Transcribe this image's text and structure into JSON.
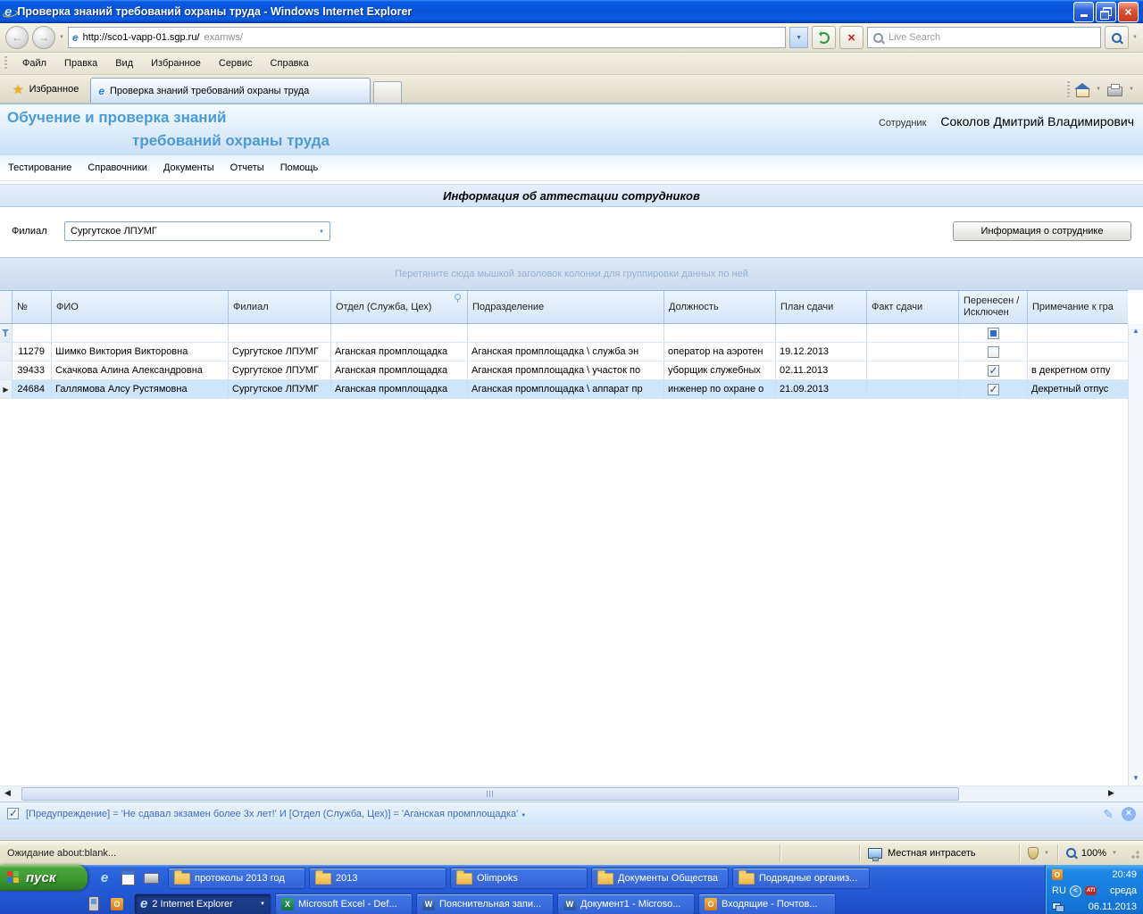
{
  "window": {
    "title": "Проверка знаний требований охраны труда - Windows Internet Explorer"
  },
  "browser": {
    "url_host": "http://sco1-vapp-01.sgp.ru/",
    "url_path": "examws/",
    "search_placeholder": "Live Search",
    "menu": [
      "Файл",
      "Правка",
      "Вид",
      "Избранное",
      "Сервис",
      "Справка"
    ],
    "favorites_label": "Избранное",
    "tab_title": "Проверка знаний требований охраны труда",
    "status_left": "Ожидание about:blank...",
    "status_zone": "Местная интрасеть",
    "status_zoom": "100%"
  },
  "app": {
    "title_line1": "Обучение и проверка знаний",
    "title_line2": "требований охраны труда",
    "user_label": "Сотрудник",
    "user_name": "Соколов Дмитрий Владимирович",
    "nav": [
      "Тестирование",
      "Справочники",
      "Документы",
      "Отчеты",
      "Помощь"
    ],
    "page_title": "Информация об аттестации сотрудников",
    "filial_label": "Филиал",
    "filial_value": "Сургутское ЛПУМГ",
    "info_button_label": "Информация о сотруднике"
  },
  "grid": {
    "group_hint": "Перетяните сюда мышкой заголовок колонки для группировки данных по ней",
    "columns": [
      "№",
      "ФИО",
      "Филиал",
      "Отдел (Служба, Цех)",
      "Подразделение",
      "Должность",
      "План сдачи",
      "Факт сдачи",
      "Перенесен /Исключен",
      "Примечание к гра"
    ],
    "filter_checkbox_indeterminate": true,
    "rows": [
      {
        "cells": [
          "11279",
          "Шимко Виктория Викторовна",
          "Сургутское ЛПУМГ",
          "Аганская промплощадка",
          "Аганская промплощадка \\ служба эн",
          "оператор на аэротен",
          "19.12.2013",
          "",
          ""
        ],
        "checked": false,
        "selected": false
      },
      {
        "cells": [
          "39433",
          "Скачкова Алина Александровна",
          "Сургутское ЛПУМГ",
          "Аганская промплощадка",
          "Аганская промплощадка \\ участок по",
          "уборщик служебных",
          "02.11.2013",
          "",
          "в декретном отпу"
        ],
        "checked": true,
        "selected": false
      },
      {
        "cells": [
          "24684",
          "Галлямова Алсу Рустямовна",
          "Сургутское ЛПУМГ",
          "Аганская промплощадка",
          "Аганская промплощадка \\ аппарат пр",
          "инженер по охране о",
          "21.09.2013",
          "",
          "Декретный отпус"
        ],
        "checked": true,
        "selected": true
      }
    ]
  },
  "filter": {
    "enabled": true,
    "text": "[Предупреждение] = 'Не сдавал экзамен более 3х лет!' И [Отдел (Служба, Цех)] = 'Аганская промплощадка'"
  },
  "taskbar": {
    "start_label": "пуск",
    "row1": [
      "протоколы 2013 год",
      "2013",
      "Olimpoks",
      "Документы Общества",
      "Подрядные организ..."
    ],
    "row2": [
      "2 Internet Explorer",
      "Microsoft Excel - Def...",
      "Пояснительная запи...",
      "Документ1 - Microso...",
      "Входящие - Почтов..."
    ],
    "tray": {
      "time": "20:49",
      "lang": "RU",
      "day": "среда",
      "date": "06.11.2013"
    }
  },
  "colors": {
    "titlebar_blue": "#0855dd",
    "taskbar_blue": "#2459d6",
    "app_accent": "#4c9bd6",
    "selected_row": "#cfe5fb",
    "grid_header_bg": "#dbe9f8"
  }
}
